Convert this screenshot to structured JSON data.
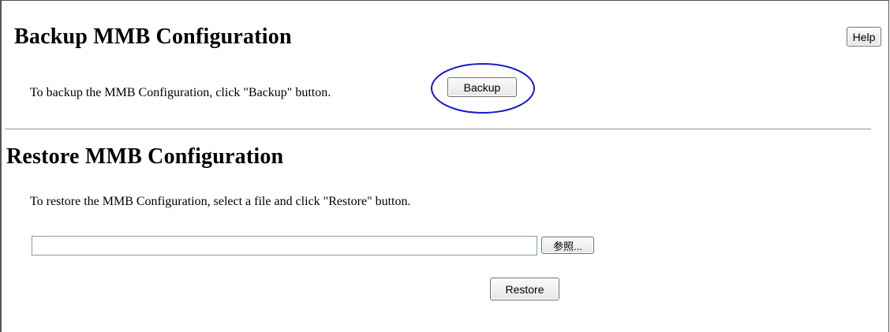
{
  "backup_section": {
    "title": "Backup MMB Configuration",
    "instruction": "To backup the MMB Configuration, click \"Backup\" button.",
    "backup_label": "Backup"
  },
  "help_label": "Help",
  "restore_section": {
    "title": "Restore MMB Configuration",
    "instruction": "To restore the MMB Configuration, select a file and click \"Restore\" button.",
    "file_input_value": "",
    "browse_label": "参照...",
    "restore_label": "Restore"
  },
  "annotation": {
    "highlight_color": "#1a1acc",
    "highlighted": "backup-button"
  }
}
